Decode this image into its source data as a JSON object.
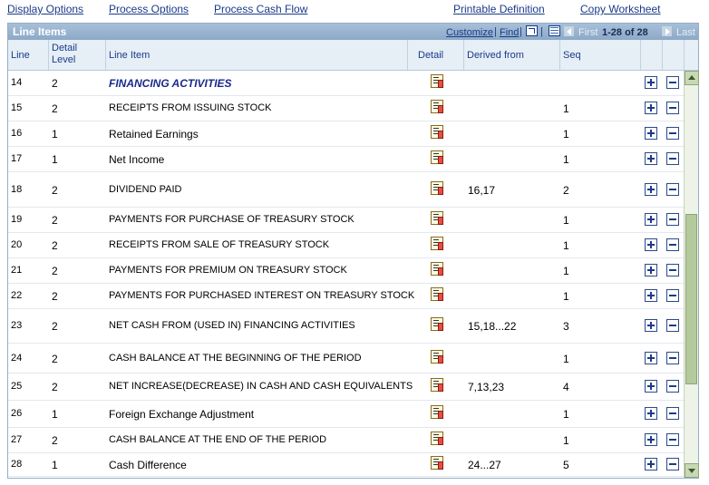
{
  "toolbar": {
    "display_options": "Display Options",
    "process_options": "Process Options",
    "process_cash_flow": "Process Cash Flow",
    "printable_definition": "Printable Definition",
    "copy_worksheet": "Copy Worksheet"
  },
  "grid": {
    "title": "Line Items",
    "customize": "Customize",
    "find": "Find",
    "separator": "|",
    "zoom_icon": "zoom-icon",
    "download_icon": "download-grid-icon",
    "first": "First",
    "range": "1-28 of 28",
    "last": "Last",
    "scroll_position": 0.62,
    "scroll_visible_fraction": 0.45
  },
  "columns": {
    "line": "Line",
    "detail_level": "Detail Level",
    "line_item": "Line Item",
    "detail": "Detail",
    "derived_from": "Derived from",
    "seq": "Seq"
  },
  "colors": {
    "header_bar": "#8ca9c7",
    "link": "#1a3a8a",
    "section": "#1a2a8a"
  },
  "rows": [
    {
      "line": "14",
      "level": "2",
      "item": "FINANCING ACTIVITIES",
      "derived": "",
      "seq": "",
      "style": "section"
    },
    {
      "line": "15",
      "level": "2",
      "item": "RECEIPTS FROM ISSUING STOCK",
      "derived": "",
      "seq": "1",
      "style": "caps"
    },
    {
      "line": "16",
      "level": "1",
      "item": "Retained Earnings",
      "derived": "",
      "seq": "1",
      "style": "big"
    },
    {
      "line": "17",
      "level": "1",
      "item": "Net Income",
      "derived": "",
      "seq": "1",
      "style": "big"
    },
    {
      "line": "18",
      "level": "2",
      "item": "DIVIDEND PAID",
      "derived": "16,17",
      "seq": "2",
      "style": "caps"
    },
    {
      "line": "19",
      "level": "2",
      "item": "PAYMENTS FOR PURCHASE OF TREASURY STOCK",
      "derived": "",
      "seq": "1",
      "style": "caps"
    },
    {
      "line": "20",
      "level": "2",
      "item": "RECEIPTS FROM SALE OF TREASURY STOCK",
      "derived": "",
      "seq": "1",
      "style": "caps"
    },
    {
      "line": "21",
      "level": "2",
      "item": "PAYMENTS FOR PREMIUM ON TREASURY STOCK",
      "derived": "",
      "seq": "1",
      "style": "caps"
    },
    {
      "line": "22",
      "level": "2",
      "item": "PAYMENTS FOR PURCHASED INTEREST ON TREASURY STOCK",
      "derived": "",
      "seq": "1",
      "style": "caps"
    },
    {
      "line": "23",
      "level": "2",
      "item": "NET CASH FROM (USED IN) FINANCING ACTIVITIES",
      "derived": "15,18...22",
      "seq": "3",
      "style": "caps"
    },
    {
      "line": "24",
      "level": "2",
      "item": "CASH BALANCE AT THE BEGINNING OF THE PERIOD",
      "derived": "",
      "seq": "1",
      "style": "caps"
    },
    {
      "line": "25",
      "level": "2",
      "item": "NET INCREASE(DECREASE) IN CASH AND CASH EQUIVALENTS",
      "derived": "7,13,23",
      "seq": "4",
      "style": "caps"
    },
    {
      "line": "26",
      "level": "1",
      "item": "Foreign Exchange Adjustment",
      "derived": "",
      "seq": "1",
      "style": "big"
    },
    {
      "line": "27",
      "level": "2",
      "item": "CASH BALANCE AT THE END OF THE PERIOD",
      "derived": "",
      "seq": "1",
      "style": "caps"
    },
    {
      "line": "28",
      "level": "1",
      "item": "Cash Difference",
      "derived": "24...27",
      "seq": "5",
      "style": "big"
    }
  ]
}
